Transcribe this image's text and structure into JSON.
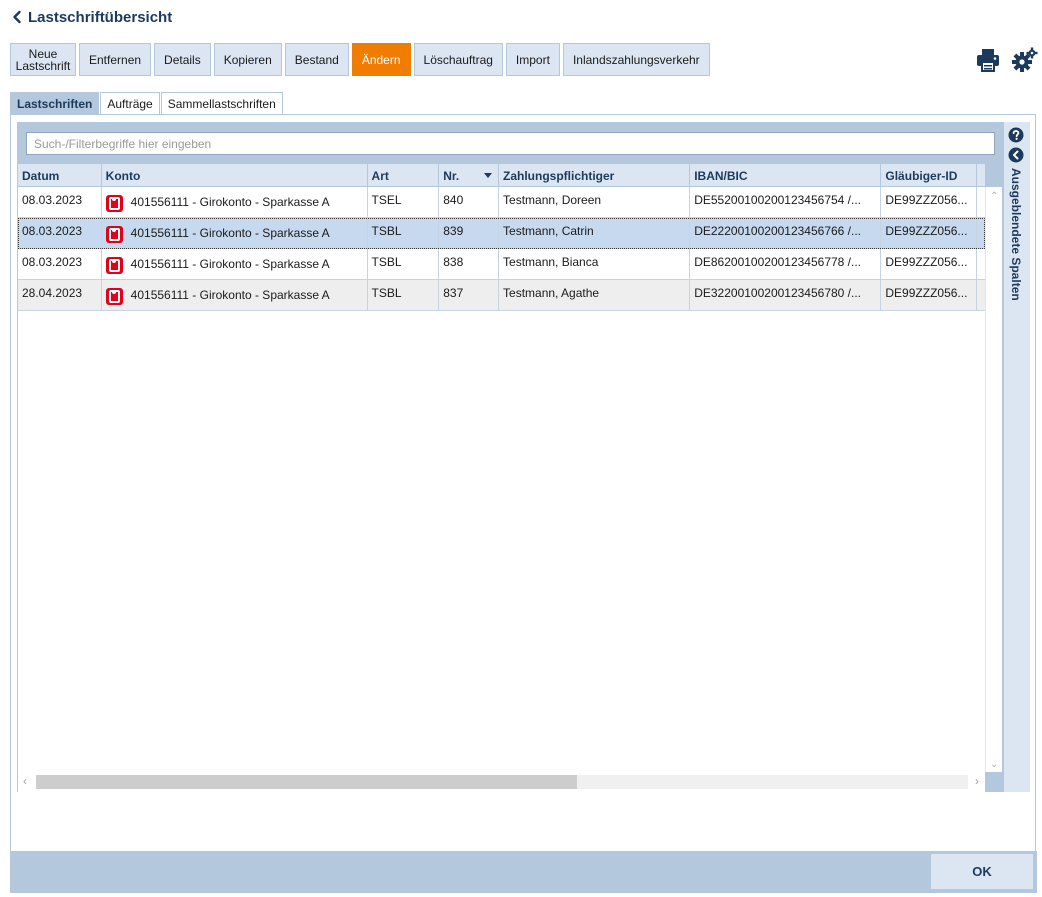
{
  "window": {
    "title": "Lastschriftübersicht"
  },
  "toolbar": {
    "buttons": [
      {
        "label": "Neue\nLastschrift",
        "active": false
      },
      {
        "label": "Entfernen",
        "active": false
      },
      {
        "label": "Details",
        "active": false
      },
      {
        "label": "Kopieren",
        "active": false
      },
      {
        "label": "Bestand",
        "active": false
      },
      {
        "label": "Ändern",
        "active": true
      },
      {
        "label": "Löschauftrag",
        "active": false
      },
      {
        "label": "Import",
        "active": false
      },
      {
        "label": "Inlandszahlungsverkehr",
        "active": false
      }
    ],
    "icons": [
      "print-icon",
      "settings-icon"
    ]
  },
  "tabs": [
    {
      "label": "Lastschriften",
      "active": true
    },
    {
      "label": "Aufträge",
      "active": false
    },
    {
      "label": "Sammellastschriften",
      "active": false
    }
  ],
  "search": {
    "placeholder": "Such-/Filterbegriffe hier eingeben",
    "value": ""
  },
  "table": {
    "columns": [
      "Datum",
      "Konto",
      "Art",
      "Nr.",
      "Zahlungspflichtiger",
      "IBAN/BIC",
      "Gläubiger-ID"
    ],
    "sort_column": "Nr.",
    "rows": [
      {
        "datum": "08.03.2023",
        "konto": "401556111 - Girokonto - Sparkasse A",
        "art": "TSEL",
        "nr": "840",
        "zahlungspflichtiger": "Testmann, Doreen",
        "iban": "DE55200100200123456754 /...",
        "glaeubiger": "DE99ZZZ056...",
        "selected": false
      },
      {
        "datum": "08.03.2023",
        "konto": "401556111 - Girokonto - Sparkasse A",
        "art": "TSBL",
        "nr": "839",
        "zahlungspflichtiger": "Testmann, Catrin",
        "iban": "DE22200100200123456766 /...",
        "glaeubiger": "DE99ZZZ056...",
        "selected": true
      },
      {
        "datum": "08.03.2023",
        "konto": "401556111 - Girokonto - Sparkasse A",
        "art": "TSBL",
        "nr": "838",
        "zahlungspflichtiger": "Testmann, Bianca",
        "iban": "DE86200100200123456778 /...",
        "glaeubiger": "DE99ZZZ056...",
        "selected": false
      },
      {
        "datum": "28.04.2023",
        "konto": "401556111 - Girokonto - Sparkasse A",
        "art": "TSBL",
        "nr": "837",
        "zahlungspflichtiger": "Testmann, Agathe",
        "iban": "DE32200100200123456780 /...",
        "glaeubiger": "DE99ZZZ056...",
        "selected": false
      }
    ],
    "account_icon": "sparkasse-icon"
  },
  "side_panel": {
    "label": "Ausgeblendete Spalten",
    "icons": [
      "help-icon",
      "collapse-icon"
    ]
  },
  "footer": {
    "ok_label": "OK"
  },
  "colors": {
    "accent": "#f07d00",
    "header_blue": "#1b3a5c",
    "panel_blue": "#b3c7dd",
    "light_blue": "#dbe6f2",
    "selected_row": "#c7d9ee",
    "bank_red": "#e2001a"
  }
}
